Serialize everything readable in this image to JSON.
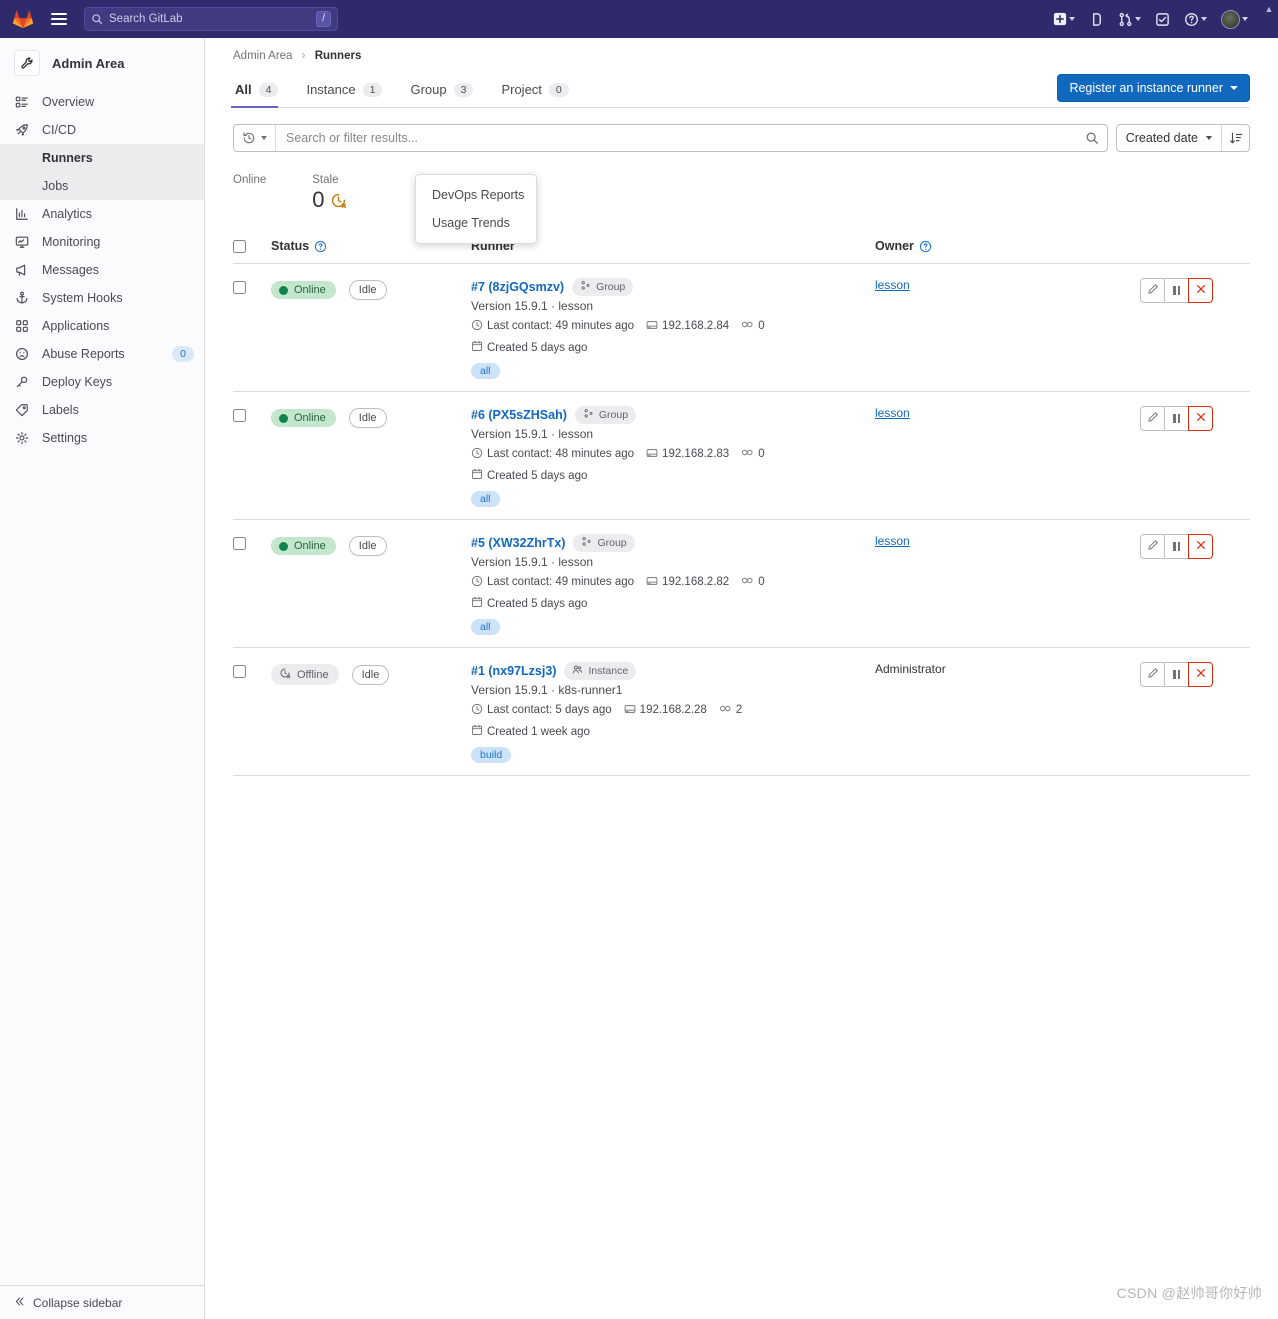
{
  "navbar": {
    "logo_icon": "gitlab-logo-icon",
    "hamburger_icon": "hamburger-menu-icon",
    "search_placeholder": "Search GitLab",
    "search_value": "",
    "search_icon": "search-icon",
    "slash_key": "/",
    "actions": [
      {
        "icon": "new-plus-icon",
        "has_caret": true
      },
      {
        "icon": "issues-icon",
        "has_caret": false
      },
      {
        "icon": "merge-requests-icon",
        "has_caret": true
      },
      {
        "icon": "todos-checkbox-icon",
        "has_caret": false
      },
      {
        "icon": "help-question-icon",
        "has_caret": true
      },
      {
        "icon": "user-avatar",
        "has_caret": true
      }
    ]
  },
  "sidebar": {
    "header": {
      "label": "Admin Area",
      "icon": "wrench-icon"
    },
    "items": [
      {
        "label": "Overview",
        "icon": "overview-list-icon",
        "badge": null
      },
      {
        "label": "CI/CD",
        "icon": "rocket-icon",
        "badge": null
      },
      {
        "label": "Analytics",
        "icon": "chart-bar-icon",
        "badge": null
      },
      {
        "label": "Monitoring",
        "icon": "monitor-icon",
        "badge": null
      },
      {
        "label": "Messages",
        "icon": "megaphone-icon",
        "badge": null
      },
      {
        "label": "System Hooks",
        "icon": "anchor-icon",
        "badge": null
      },
      {
        "label": "Applications",
        "icon": "apps-grid-icon",
        "badge": null
      },
      {
        "label": "Abuse Reports",
        "icon": "abuse-face-icon",
        "badge": "0"
      },
      {
        "label": "Deploy Keys",
        "icon": "key-icon",
        "badge": null
      },
      {
        "label": "Labels",
        "icon": "label-tag-icon",
        "badge": null
      },
      {
        "label": "Settings",
        "icon": "gear-icon",
        "badge": null
      }
    ],
    "subitems": [
      {
        "label": "Runners",
        "active": true
      },
      {
        "label": "Jobs",
        "active": false
      }
    ],
    "collapse": {
      "label": "Collapse sidebar",
      "icon": "chevron-double-left-icon"
    }
  },
  "breadcrumb": {
    "root": "Admin Area",
    "separator": "›",
    "current": "Runners"
  },
  "tabs": [
    {
      "label": "All",
      "count": "4",
      "active": true
    },
    {
      "label": "Instance",
      "count": "1",
      "active": false
    },
    {
      "label": "Group",
      "count": "3",
      "active": false
    },
    {
      "label": "Project",
      "count": "0",
      "active": false
    }
  ],
  "register_button": {
    "label": "Register an instance runner",
    "caret_icon": "chevron-down-icon"
  },
  "filter": {
    "history_icon": "history-clock-icon",
    "placeholder": "Search or filter results...",
    "value": "",
    "search_icon": "search-icon",
    "sort_label": "Created date",
    "sort_direction_icon": "sort-descending-icon"
  },
  "dropdown_menu": {
    "items": [
      {
        "label": "DevOps Reports"
      },
      {
        "label": "Usage Trends"
      }
    ]
  },
  "stats": [
    {
      "label": "Online",
      "value": "",
      "partial": true,
      "icon": ""
    },
    {
      "label": "Stale",
      "value": "0",
      "icon": "clock-x-icon",
      "icon_color": "#c17d10"
    }
  ],
  "table": {
    "headers": {
      "status": "Status",
      "status_help_icon": "question-circle-icon",
      "runner": "Runner",
      "owner": "Owner",
      "owner_help_icon": "question-circle-icon"
    },
    "rows": [
      {
        "status": "Online",
        "status_type": "online",
        "state": "Idle",
        "name": "#7 (8zjGQsmzv)",
        "type_badge": "Group",
        "type_icon": "group-icon",
        "version_line": "Version 15.9.1 · lesson",
        "last_contact_icon": "clock-icon",
        "last_contact": "Last contact: 49 minutes ago",
        "ip_icon": "server-icon",
        "ip": "192.168.2.84",
        "jobs_icon": "link-chain-icon",
        "jobs": "0",
        "created_icon": "calendar-icon",
        "created": "Created 5 days ago",
        "tag": "all",
        "owner": "lesson",
        "owner_is_link": true,
        "actions": [
          {
            "icon": "pencil-edit-icon",
            "kind": "edit"
          },
          {
            "icon": "pause-icon",
            "kind": "pause"
          },
          {
            "icon": "close-x-icon",
            "kind": "delete"
          }
        ]
      },
      {
        "status": "Online",
        "status_type": "online",
        "state": "Idle",
        "name": "#6 (PX5sZHSah)",
        "type_badge": "Group",
        "type_icon": "group-icon",
        "version_line": "Version 15.9.1 · lesson",
        "last_contact_icon": "clock-icon",
        "last_contact": "Last contact: 48 minutes ago",
        "ip_icon": "server-icon",
        "ip": "192.168.2.83",
        "jobs_icon": "link-chain-icon",
        "jobs": "0",
        "created_icon": "calendar-icon",
        "created": "Created 5 days ago",
        "tag": "all",
        "owner": "lesson",
        "owner_is_link": true,
        "actions": [
          {
            "icon": "pencil-edit-icon",
            "kind": "edit"
          },
          {
            "icon": "pause-icon",
            "kind": "pause"
          },
          {
            "icon": "close-x-icon",
            "kind": "delete"
          }
        ]
      },
      {
        "status": "Online",
        "status_type": "online",
        "state": "Idle",
        "name": "#5 (XW32ZhrTx)",
        "type_badge": "Group",
        "type_icon": "group-icon",
        "version_line": "Version 15.9.1 · lesson",
        "last_contact_icon": "clock-icon",
        "last_contact": "Last contact: 49 minutes ago",
        "ip_icon": "server-icon",
        "ip": "192.168.2.82",
        "jobs_icon": "link-chain-icon",
        "jobs": "0",
        "created_icon": "calendar-icon",
        "created": "Created 5 days ago",
        "tag": "all",
        "owner": "lesson",
        "owner_is_link": true,
        "actions": [
          {
            "icon": "pencil-edit-icon",
            "kind": "edit"
          },
          {
            "icon": "pause-icon",
            "kind": "pause"
          },
          {
            "icon": "close-x-icon",
            "kind": "delete"
          }
        ]
      },
      {
        "status": "Offline",
        "status_type": "offline",
        "state": "Idle",
        "name": "#1 (nx97Lzsj3)",
        "type_badge": "Instance",
        "type_icon": "instance-users-icon",
        "version_line": "Version 15.9.1 · k8s-runner1",
        "last_contact_icon": "clock-icon",
        "last_contact": "Last contact: 5 days ago",
        "ip_icon": "server-icon",
        "ip": "192.168.2.28",
        "jobs_icon": "link-chain-icon",
        "jobs": "2",
        "created_icon": "calendar-icon",
        "created": "Created 1 week ago",
        "tag": "build",
        "owner": "Administrator",
        "owner_is_link": false,
        "actions": [
          {
            "icon": "pencil-edit-icon",
            "kind": "edit"
          },
          {
            "icon": "pause-icon",
            "kind": "pause"
          },
          {
            "icon": "close-x-icon",
            "kind": "delete"
          }
        ]
      }
    ]
  },
  "watermark": "CSDN @赵帅哥你好帅",
  "colors": {
    "navbar_bg": "#2f2a6b",
    "primary_blue": "#1068bf",
    "link_blue": "#1f75cb",
    "online_green": "#108548",
    "danger_red": "#dd2b0e",
    "stale_orange": "#c17d10"
  }
}
